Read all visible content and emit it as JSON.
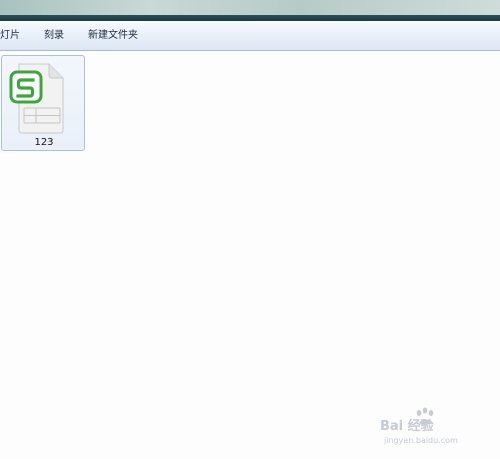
{
  "toolbar": {
    "items": [
      {
        "label": "灯片"
      },
      {
        "label": "刻录"
      },
      {
        "label": "新建文件夹"
      }
    ]
  },
  "files": [
    {
      "name": "123",
      "icon": "spreadsheet-s-file-icon",
      "accent": "#3ca63c"
    }
  ],
  "watermark": {
    "brand": "Bai 经验",
    "url": "jingyan.baidu.com"
  },
  "colors": {
    "toolbar_text": "#1e2e44",
    "selection_border": "#a8c1dd",
    "file_accent": "#3ca63c"
  }
}
